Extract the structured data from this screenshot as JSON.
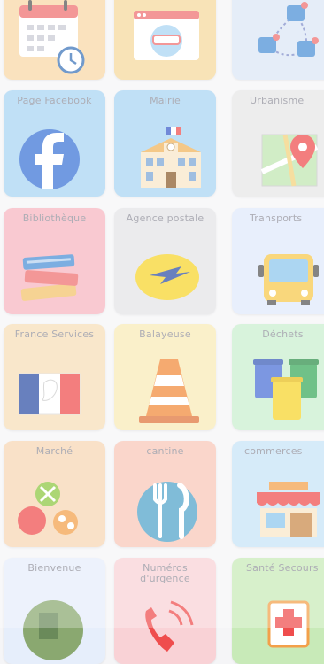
{
  "tiles": [
    {
      "label": "",
      "color": "#f8d7a6",
      "icon": "calendar-clock-icon"
    },
    {
      "label": "",
      "color": "#f5d99b",
      "icon": "browser-window-icon"
    },
    {
      "label": "",
      "color": "#dce7f6",
      "icon": "network-nodes-icon"
    },
    {
      "label": "Page Facebook",
      "color": "#a8d4f3",
      "icon": "facebook-icon"
    },
    {
      "label": "Mairie",
      "color": "#a8d4f3",
      "icon": "town-hall-icon"
    },
    {
      "label": "Urbanisme",
      "color": "#e6e6e6",
      "icon": "map-pin-icon"
    },
    {
      "label": "Bibliothèque",
      "color": "#f7b4bf",
      "icon": "books-icon"
    },
    {
      "label": "Agence postale",
      "color": "#e3e3e6",
      "icon": "la-poste-icon"
    },
    {
      "label": "Transports",
      "color": "#dfe9fb",
      "icon": "bus-icon"
    },
    {
      "label": "France Services",
      "color": "#f7deb8",
      "icon": "marianne-icon"
    },
    {
      "label": "Balayeuse",
      "color": "#f9eab6",
      "icon": "traffic-cone-icon"
    },
    {
      "label": "Déchets",
      "color": "#c9efcf",
      "icon": "waste-bins-icon"
    },
    {
      "label": "Marché",
      "color": "#f7d6b3",
      "icon": "produce-icon"
    },
    {
      "label": "cantine",
      "color": "#f8c7b7",
      "icon": "fork-knife-icon"
    },
    {
      "label": "commerces",
      "color": "#c7e3f7",
      "icon": "shop-icon"
    },
    {
      "label": "Bienvenue",
      "color": "#e6eefb",
      "icon": "landscape-icon"
    },
    {
      "label": "Numéros d'urgence",
      "color": "#f9d2d6",
      "icon": "phone-icon"
    },
    {
      "label": "Santé Secours",
      "color": "#c8eab8",
      "icon": "first-aid-icon"
    }
  ]
}
